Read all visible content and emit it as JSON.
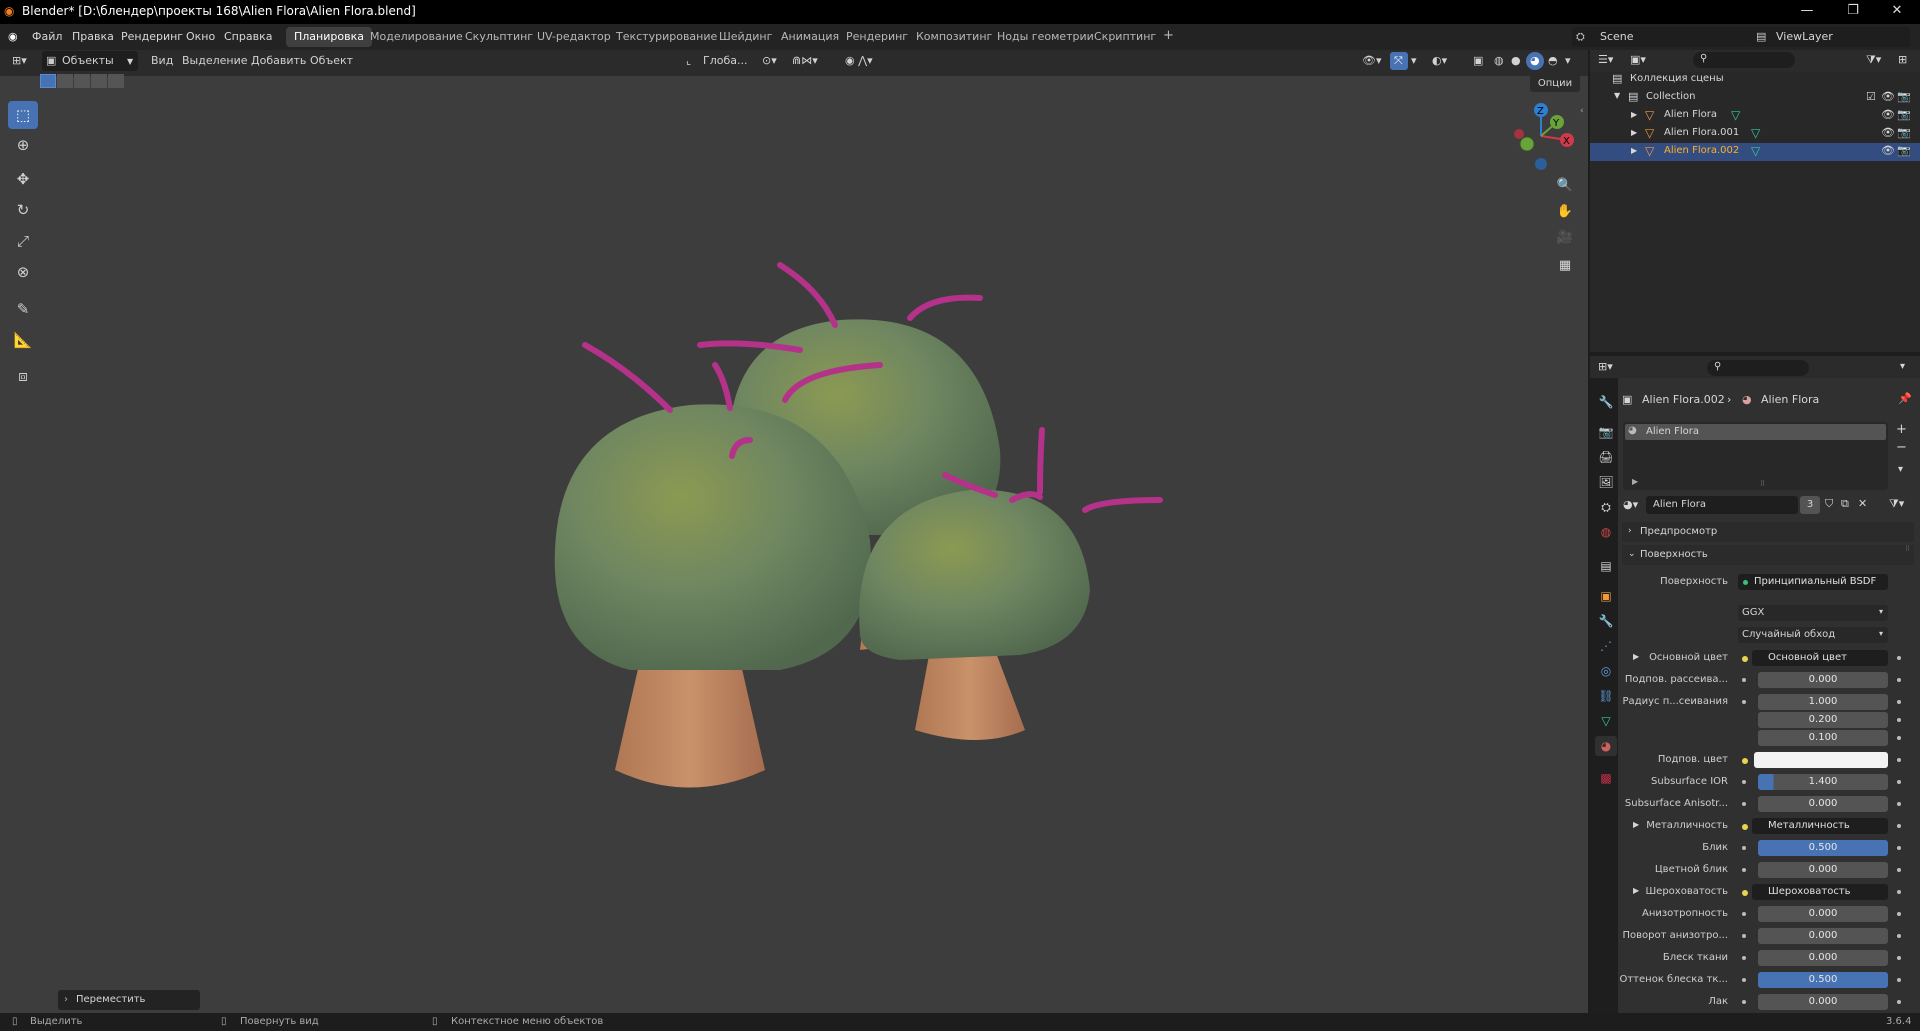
{
  "window": {
    "title": "Blender* [D:\\блендер\\проекты 168\\Alien Flora\\Alien Flora.blend]"
  },
  "menu": [
    "Файл",
    "Правка",
    "Рендеринг",
    "Окно",
    "Справка"
  ],
  "workspaces": [
    "Планировка",
    "Моделирование",
    "Скульптинг",
    "UV-редактор",
    "Текстурирование",
    "Шейдинг",
    "Анимация",
    "Рендеринг",
    "Композитинг",
    "Ноды геометрии",
    "Скриптинг"
  ],
  "top_right": {
    "scene": "Scene",
    "view_layer": "ViewLayer"
  },
  "viewport": {
    "mode": "Объекты",
    "menu": [
      "Вид",
      "Выделение",
      "Добавить",
      "Объект"
    ],
    "orientation": "Глоба...",
    "options": "Опции",
    "last_op": "Переместить",
    "gizmo": {
      "z": "Z",
      "y": "Y",
      "x": "X"
    }
  },
  "outliner": {
    "scene_collection": "Коллекция сцены",
    "collection": "Collection",
    "items": [
      "Alien Flora",
      "Alien Flora.001",
      "Alien Flora.002"
    ]
  },
  "props": {
    "breadcrumb_obj": "Alien Flora.002",
    "breadcrumb_mat": "Alien Flora",
    "slot": "Alien Flora",
    "material": "Alien Flora",
    "users": "3",
    "panels": {
      "preview": "Предпросмотр",
      "surface": "Поверхность"
    },
    "surface_label": "Поверхность",
    "surface_value": "Принципиальный BSDF",
    "distribution": "GGX",
    "subsurface_method": "Случайный обход",
    "rows": [
      {
        "label": "Основной цвет",
        "type": "link",
        "value": "Основной цвет"
      },
      {
        "label": "Подпов. рассеива...",
        "type": "num",
        "value": "0.000"
      },
      {
        "label": "Радиус п...сеивания",
        "type": "num",
        "value": "1.000"
      },
      {
        "label": "",
        "type": "num",
        "value": "0.200"
      },
      {
        "label": "",
        "type": "num",
        "value": "0.100"
      },
      {
        "label": "Подпов. цвет",
        "type": "color",
        "value": ""
      },
      {
        "label": "Subsurface IOR",
        "type": "num",
        "value": "1.400",
        "fill": 0.12
      },
      {
        "label": "Subsurface Anisotr...",
        "type": "num",
        "value": "0.000"
      },
      {
        "label": "Металличность",
        "type": "link",
        "value": "Металличность"
      },
      {
        "label": "Блик",
        "type": "num",
        "value": "0.500",
        "fill": 1.0
      },
      {
        "label": "Цветной блик",
        "type": "num",
        "value": "0.000"
      },
      {
        "label": "Шероховатость",
        "type": "link",
        "value": "Шероховатость"
      },
      {
        "label": "Анизотропность",
        "type": "num",
        "value": "0.000"
      },
      {
        "label": "Поворот анизотро...",
        "type": "num",
        "value": "0.000"
      },
      {
        "label": "Блеск ткани",
        "type": "num",
        "value": "0.000"
      },
      {
        "label": "Оттенок блеска тк...",
        "type": "num",
        "value": "0.500",
        "fill": 1.0
      },
      {
        "label": "Лак",
        "type": "num",
        "value": "0.000"
      }
    ]
  },
  "status": {
    "select": "Выделить",
    "rotate": "Повернуть вид",
    "context": "Контекстное меню объектов",
    "version": "3.6.4"
  },
  "colors": {
    "accent": "#4772b3",
    "selected_row": "#334d80",
    "cap": "#7f8f4a",
    "stem": "#c48a62",
    "spike": "#b5328a"
  }
}
